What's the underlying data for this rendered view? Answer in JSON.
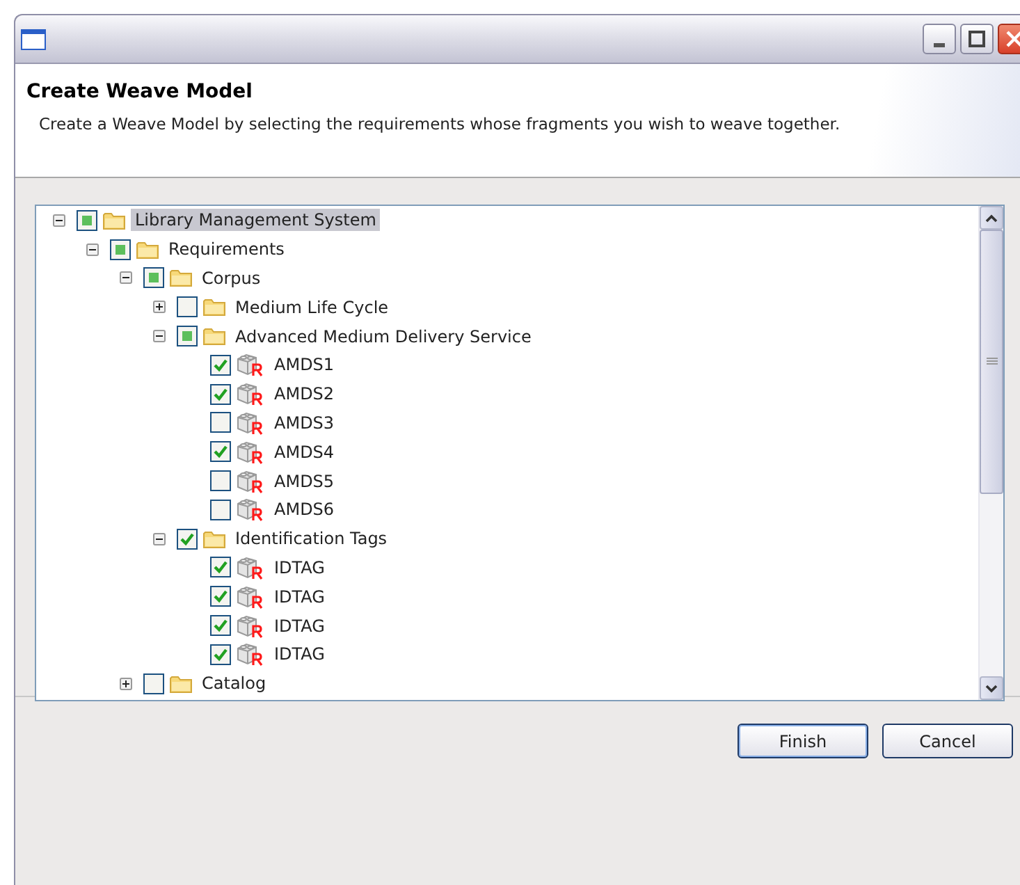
{
  "dialog": {
    "title": "Create Weave Model",
    "description": "Create a Weave Model by selecting the requirements whose fragments you wish to weave together."
  },
  "tree": [
    {
      "label": "Library Management System",
      "kind": "folder",
      "expanded": true,
      "checked": false,
      "partial": true,
      "selected": true,
      "children": [
        {
          "label": "Requirements",
          "kind": "folder",
          "expanded": true,
          "checked": false,
          "partial": true,
          "selected": false,
          "children": [
            {
              "label": "Corpus",
              "kind": "folder",
              "expanded": true,
              "checked": false,
              "partial": true,
              "selected": false,
              "children": [
                {
                  "label": "Medium Life Cycle",
                  "kind": "folder",
                  "expanded": false,
                  "checked": false,
                  "partial": false,
                  "selected": false
                },
                {
                  "label": "Advanced Medium Delivery Service",
                  "kind": "folder",
                  "expanded": true,
                  "checked": false,
                  "partial": true,
                  "selected": false,
                  "children": [
                    {
                      "label": "AMDS1",
                      "kind": "requirement",
                      "checked": true,
                      "partial": false,
                      "selected": false
                    },
                    {
                      "label": "AMDS2",
                      "kind": "requirement",
                      "checked": true,
                      "partial": false,
                      "selected": false
                    },
                    {
                      "label": "AMDS3",
                      "kind": "requirement",
                      "checked": false,
                      "partial": false,
                      "selected": false
                    },
                    {
                      "label": "AMDS4",
                      "kind": "requirement",
                      "checked": true,
                      "partial": false,
                      "selected": false
                    },
                    {
                      "label": "AMDS5",
                      "kind": "requirement",
                      "checked": false,
                      "partial": false,
                      "selected": false
                    },
                    {
                      "label": "AMDS6",
                      "kind": "requirement",
                      "checked": false,
                      "partial": false,
                      "selected": false
                    }
                  ]
                },
                {
                  "label": "Identification Tags",
                  "kind": "folder",
                  "expanded": true,
                  "checked": true,
                  "partial": false,
                  "selected": false,
                  "children": [
                    {
                      "label": "IDTAG",
                      "kind": "requirement",
                      "checked": true,
                      "partial": false,
                      "selected": false
                    },
                    {
                      "label": "IDTAG",
                      "kind": "requirement",
                      "checked": true,
                      "partial": false,
                      "selected": false
                    },
                    {
                      "label": "IDTAG",
                      "kind": "requirement",
                      "checked": true,
                      "partial": false,
                      "selected": false
                    },
                    {
                      "label": "IDTAG",
                      "kind": "requirement",
                      "checked": true,
                      "partial": false,
                      "selected": false
                    }
                  ]
                }
              ]
            },
            {
              "label": "Catalog",
              "kind": "folder",
              "expanded": false,
              "checked": false,
              "partial": false,
              "selected": false
            }
          ]
        }
      ]
    }
  ],
  "buttons": [
    {
      "label": "Finish",
      "default": true
    },
    {
      "label": "Cancel",
      "default": false
    }
  ]
}
